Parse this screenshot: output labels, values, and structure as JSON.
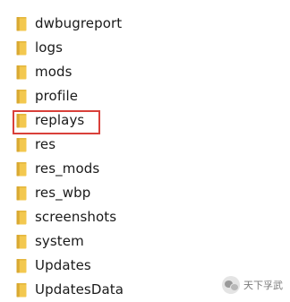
{
  "folders": [
    {
      "label": "dwbugreport",
      "selected": false
    },
    {
      "label": "logs",
      "selected": false
    },
    {
      "label": "mods",
      "selected": false
    },
    {
      "label": "profile",
      "selected": false
    },
    {
      "label": "replays",
      "selected": true
    },
    {
      "label": "res",
      "selected": false
    },
    {
      "label": "res_mods",
      "selected": false
    },
    {
      "label": "res_wbp",
      "selected": false
    },
    {
      "label": "screenshots",
      "selected": false
    },
    {
      "label": "system",
      "selected": false
    },
    {
      "label": "Updates",
      "selected": false
    },
    {
      "label": "UpdatesData",
      "selected": false
    }
  ],
  "icon": "folder-icon",
  "colors": {
    "folder_fill": "#f3c84f",
    "folder_dark": "#d9a932",
    "highlight": "#d9403a"
  },
  "watermark": {
    "text": "天下孚武",
    "icon": "wechat-icon"
  }
}
